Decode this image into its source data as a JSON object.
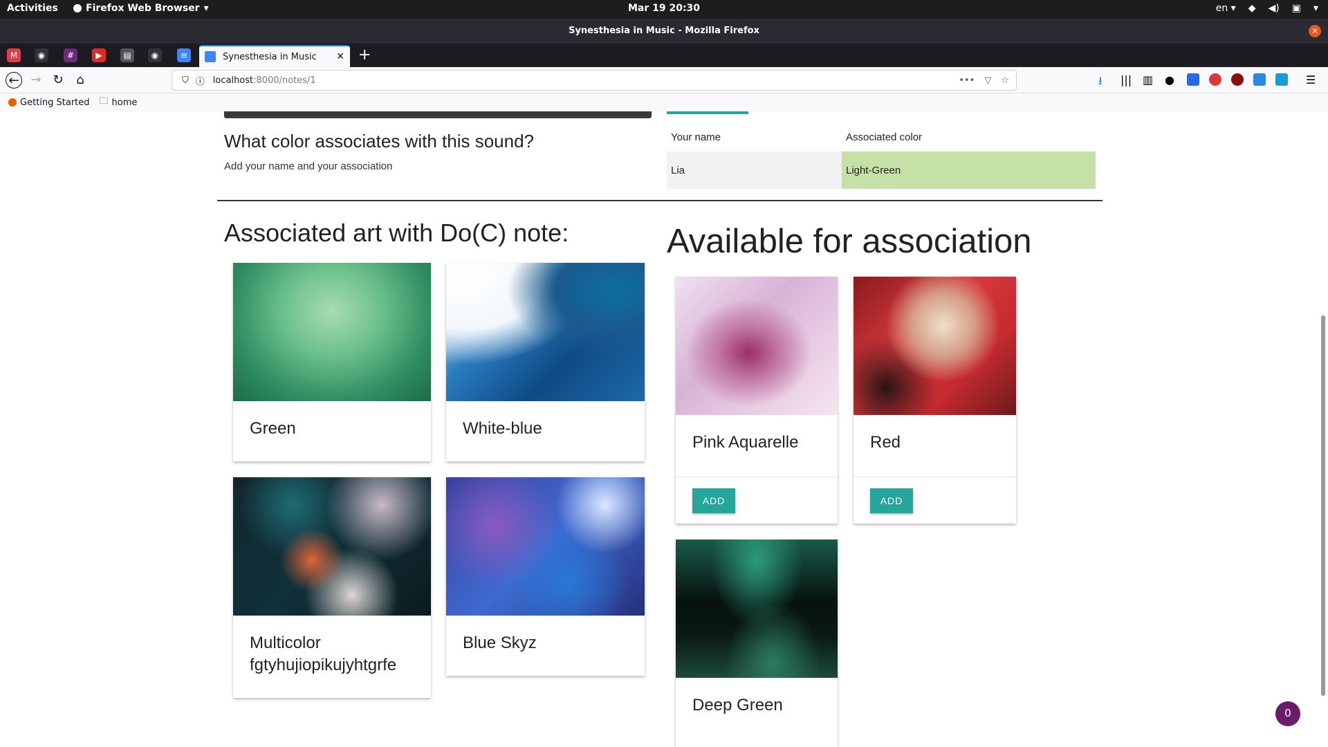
{
  "system": {
    "activities": "Activities",
    "app_name": "Firefox Web Browser",
    "clock": "Mar 19  20:30",
    "lang": "en"
  },
  "window": {
    "title": "Synesthesia in Music - Mozilla Firefox"
  },
  "tabs": {
    "active_label": "Synesthesia in Music"
  },
  "url": {
    "host": "localhost",
    "rest": ":8000/notes/1"
  },
  "bookmarks": [
    {
      "label": "Getting Started"
    },
    {
      "label": "home"
    }
  ],
  "question": {
    "title": "What color associates with this sound?",
    "subtitle": "Add your name and your association"
  },
  "table": {
    "headers": [
      "Your name",
      "Associated color"
    ],
    "rows": [
      {
        "name": "Lia",
        "color": "Light-Green",
        "color_hex": "#c5e1a5"
      }
    ]
  },
  "associated": {
    "heading": "Associated art with Do(C) note:",
    "cards": [
      {
        "title": "Green",
        "bg": "radial-gradient(ellipse at 50% 35%, #a8dcb0 0%, #6cc08c 35%, #2f8e62 70%, #1d6a4a 100%)"
      },
      {
        "title": "White-blue",
        "bg": "radial-gradient(ellipse at 85% 20%, #0d6fa0 0%, #1a5a8e 25%, transparent 45%), radial-gradient(ellipse at 10% 10%, #ffffff 0%, #f1f7fb 30%, transparent 50%), linear-gradient(135deg, #e8f2f8 0%, #2a7bbf 35%, #0f4a86 65%, #1d6aa8 100%)"
      },
      {
        "title": "Multicolor fgtyhujiopikujyhtgrfe",
        "bg": "radial-gradient(circle at 40% 60%, #e0653a 0%, transparent 22%), radial-gradient(circle at 75% 20%, #c7b9c8 0%, transparent 30%), radial-gradient(circle at 30% 20%, #1f6b74 0%, transparent 30%), radial-gradient(circle at 60% 85%, #dcd6d4 0%, transparent 28%), linear-gradient(135deg, #12262c 0%, #10313a 50%, #0c1a1e 100%)"
      },
      {
        "title": "Blue Skyz",
        "bg": "radial-gradient(circle at 80% 20%, #dbe8ff 0%, transparent 25%), radial-gradient(circle at 25% 35%, #8a5bc0 0%, transparent 35%), radial-gradient(circle at 60% 75%, #2a78d8 0%, transparent 40%), linear-gradient(135deg, #3b3f9e 0%, #3f6ad0 50%, #27307a 100%)"
      }
    ]
  },
  "available": {
    "heading": "Available for association",
    "add_label": "ADD",
    "cards": [
      {
        "title": "Pink Aquarelle",
        "bg": "radial-gradient(ellipse at 45% 55%, #9a2f68 0%, #c27aa6 25%, transparent 50%), linear-gradient(135deg, #f1e1ee 0%, #d8b2d6 40%, #e9cde4 70%, #f4e6ef 100%)",
        "has_add": true
      },
      {
        "title": "Red",
        "bg": "radial-gradient(circle at 55% 35%, #efe0c8 0%, #d69c86 25%, transparent 45%), radial-gradient(circle at 20% 80%, #2a1414 0%, transparent 30%), linear-gradient(135deg, #8a1a1e 0%, #d8393c 40%, #c42a2f 70%, #6a1a1e 100%)",
        "has_add": true
      },
      {
        "title": "Deep Green",
        "bg": "radial-gradient(ellipse at 50% 15%, #2c9a7a 0%, transparent 40%), radial-gradient(ellipse at 60% 90%, #2d7a62 0%, transparent 35%), linear-gradient(180deg, #1a5a4a 0%, #071210 45%, #0a1a16 70%, #1d4a3e 100%)",
        "has_add": false
      }
    ]
  },
  "badge": {
    "count": "0"
  }
}
